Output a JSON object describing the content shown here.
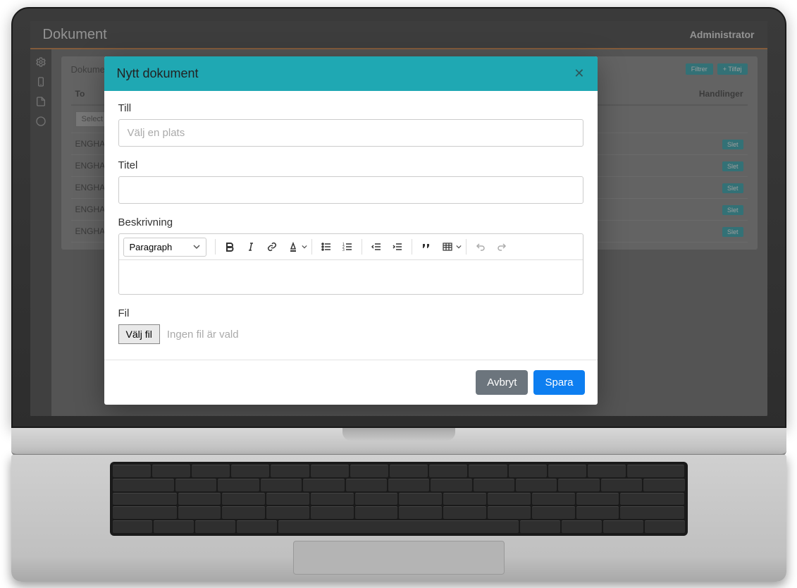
{
  "app": {
    "title": "Dokument",
    "user": "Administrator"
  },
  "panel": {
    "title": "Dokument",
    "btn_filter": "Filtrer",
    "btn_add": "+ Tilføj",
    "col_to": "To",
    "col_actions": "Handlinger",
    "select_loc": "Select a loca",
    "rows": [
      {
        "to": "ENGHAVEVEJ",
        "action": "Slet"
      },
      {
        "to": "ENGHAVEVEJ",
        "action": "Slet"
      },
      {
        "to": "ENGHAVEVEJ",
        "action": "Slet"
      },
      {
        "to": "ENGHAVEVEJ",
        "action": "Slet"
      },
      {
        "to": "ENGHAVEVEJ",
        "action": "Slet"
      }
    ]
  },
  "modal": {
    "title": "Nytt dokument",
    "label_till": "Till",
    "placeholder_till": "Välj en plats",
    "label_titel": "Titel",
    "label_desc": "Beskrivning",
    "rte_paragraph": "Paragraph",
    "label_fil": "Fil",
    "file_btn": "Välj fil",
    "file_none": "Ingen fil är vald",
    "btn_cancel": "Avbryt",
    "btn_save": "Spara"
  }
}
